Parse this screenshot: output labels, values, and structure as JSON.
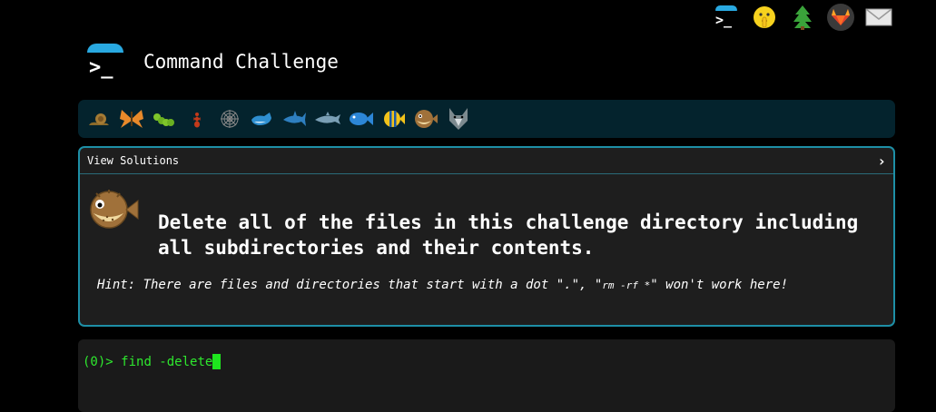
{
  "header": {
    "title": "Command Challenge",
    "prompt_glyph": ">_"
  },
  "top_icons": [
    {
      "name": "terminal-icon"
    },
    {
      "name": "shush-face-icon"
    },
    {
      "name": "tree-icon"
    },
    {
      "name": "gitlab-icon"
    },
    {
      "name": "mail-icon"
    }
  ],
  "levels": [
    {
      "name": "snail-icon"
    },
    {
      "name": "butterfly-icon"
    },
    {
      "name": "caterpillar-icon"
    },
    {
      "name": "ant-icon"
    },
    {
      "name": "spider-web-icon"
    },
    {
      "name": "whale-icon"
    },
    {
      "name": "shark-icon"
    },
    {
      "name": "dolphin-icon"
    },
    {
      "name": "fish-icon"
    },
    {
      "name": "tropical-fish-icon"
    },
    {
      "name": "pufferfish-icon"
    },
    {
      "name": "wolf-icon"
    }
  ],
  "challenge": {
    "view_solutions": "View Solutions",
    "chevron": "›",
    "task": "Delete all of the files in this challenge directory including all subdirectories and their contents.",
    "hint_prefix": "Hint: There are files and directories that start with a dot \".\", \"",
    "hint_code": "rm -rf *",
    "hint_suffix": "\" won't work here!"
  },
  "terminal": {
    "prompt": "(0)> ",
    "input": "find -delete"
  },
  "colors": {
    "accent": "#29a9e1",
    "border": "#1e8fa6",
    "terminal_green": "#2ee82e"
  }
}
